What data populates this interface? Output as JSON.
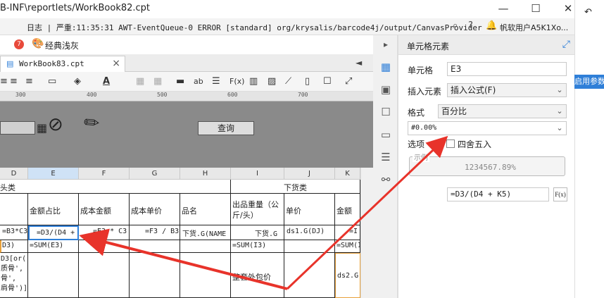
{
  "window": {
    "title": "B-INF\\reportlets/WorkBook82.cpt",
    "minimize_icon": "minimize-icon",
    "maximize_icon": "maximize-icon",
    "close_icon": "close-icon"
  },
  "logbar": {
    "text": "日志 | 严重:11:35:31 AWT-EventQueue-0 ERROR [standard] org/krysalis/barcode4j/output/CanvasProvider",
    "user": "帆软用户A5K1Xo..."
  },
  "menubar": {
    "badge_count": "7",
    "theme_label": "经典浅灰"
  },
  "tabs": [
    {
      "label": "WorkBook83.cpt",
      "close": "×"
    }
  ],
  "ruler": {
    "marks": [
      "300",
      "400",
      "500",
      "600",
      "700"
    ]
  },
  "parameter_panel": {
    "query_button": "查询"
  },
  "grid": {
    "columns": [
      "D",
      "E",
      "F",
      "G",
      "H",
      "I",
      "J",
      "K"
    ],
    "row_group_left": "头类",
    "row_group_right": "下货类",
    "headers": [
      "金额占比",
      "成本金额",
      "成本单价",
      "品名",
      "出品重量（公斤/头）",
      "单价",
      "金额"
    ],
    "row3": [
      "=B3*C3",
      "=D3/(D4 +",
      "=E3 * C3",
      "=F3 / B3",
      "下货.G(NAME",
      "下货.G",
      "ds1.G(DJ)",
      "=I"
    ],
    "row4": [
      "D3)",
      "=SUM(E3)",
      "=SUM(I3)",
      "=SUM(I"
    ],
    "row5_left": [
      "D3[or(",
      "质骨',",
      "骨',",
      "肩骨')]"
    ],
    "row5_note": "整套外包价",
    "row5_k": "ds2.G"
  },
  "right_panel": {
    "title": "单元格元素",
    "cell_label": "单元格",
    "cell_value": "E3",
    "insert_label": "插入元素",
    "insert_value": "插入公式(F)",
    "format_label": "格式",
    "format_value": "百分比",
    "pattern_value": "#0.00%",
    "option_label": "选项",
    "round_label": "四舍五入",
    "example_label": "示例",
    "example_value": "1234567.89%",
    "formula_value": "=D3/(D4 + K5)",
    "fx_label": "F(x)"
  },
  "far_right": {
    "button_label": "启用参数统"
  },
  "colors": {
    "accent": "#2f7fd8",
    "arrow": "#e8332a",
    "badge": "#e84a3b",
    "panel_gray": "#8a8a8a"
  }
}
